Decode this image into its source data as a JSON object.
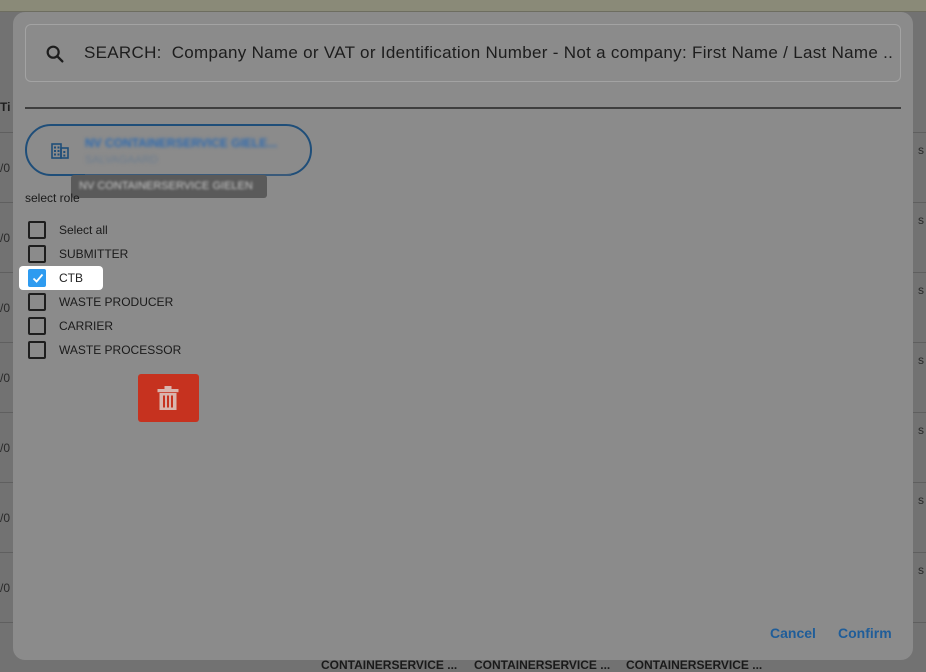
{
  "background": {
    "header_cell": "Ti",
    "left_fragments": [
      "/0",
      "/0",
      "/0",
      "/0",
      "/0",
      "/0",
      "/0"
    ],
    "right_fragments": [
      "s",
      "s",
      "s",
      "s",
      "s",
      "s",
      "s"
    ],
    "bottom_cells": [
      "CONTAINERSERVICE ...",
      "CONTAINERSERVICE ...",
      "CONTAINERSERVICE ..."
    ]
  },
  "search": {
    "icon": "search-icon",
    "placeholder": "SEARCH:  Company Name or VAT or Identification Number - Not a company: First Name / Last Name ..."
  },
  "company": {
    "icon": "building-icon",
    "name": "NV CONTAINERSERVICE GIELE...",
    "city": "SALVAGAARD",
    "tooltip": "NV CONTAINERSERVICE GIELEN"
  },
  "roles": {
    "label": "select role",
    "items": [
      {
        "label": "Select all",
        "checked": false
      },
      {
        "label": "SUBMITTER",
        "checked": false
      },
      {
        "label": "CTB",
        "checked": true
      },
      {
        "label": "WASTE PRODUCER",
        "checked": false
      },
      {
        "label": "CARRIER",
        "checked": false
      },
      {
        "label": "WASTE PROCESSOR",
        "checked": false
      }
    ]
  },
  "delete": {
    "icon": "trash-icon"
  },
  "footer": {
    "cancel_label": "Cancel",
    "confirm_label": "Confirm"
  },
  "colors": {
    "accent": "#1f5d99",
    "checkbox_checked": "#2e9bf0",
    "delete_red": "#c6321f"
  }
}
